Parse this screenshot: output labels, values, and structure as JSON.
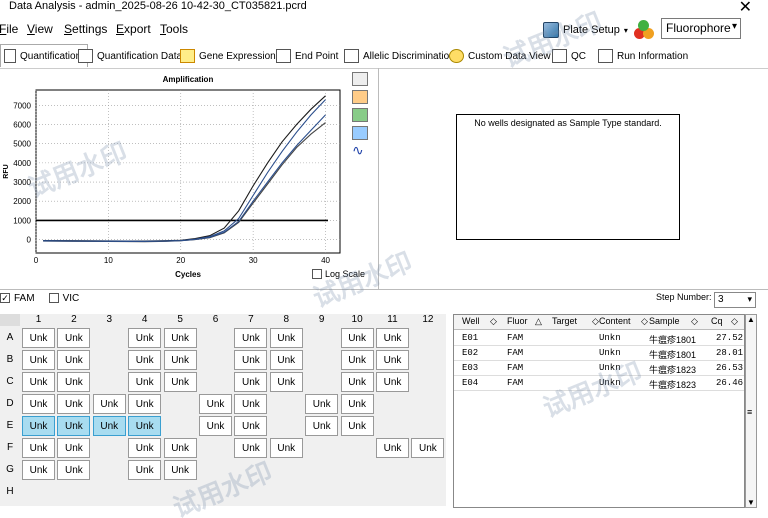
{
  "window": {
    "title": "Data Analysis - admin_2025-08-26 10-42-30_CT035821.pcrd",
    "close": "✕"
  },
  "menu": [
    {
      "key": "F",
      "rest": "ile"
    },
    {
      "key": "V",
      "rest": "iew"
    },
    {
      "key": "S",
      "rest": "ettings"
    },
    {
      "key": "E",
      "rest": "xport"
    },
    {
      "key": "T",
      "rest": "ools"
    }
  ],
  "toolbar": {
    "plate_setup": "Plate Setup",
    "fluor_select": "Fluorophore"
  },
  "tabs": [
    "Quantification",
    "Quantification Data",
    "Gene Expression",
    "End Point",
    "Allelic Discrimination",
    "Custom Data View",
    "QC",
    "Run Information"
  ],
  "chart_data": {
    "type": "line",
    "title": "Amplification",
    "xlabel": "Cycles",
    "ylabel": "RFU",
    "xlim": [
      0,
      42
    ],
    "ylim": [
      -700,
      7800
    ],
    "xticks": [
      0,
      10,
      20,
      30,
      40
    ],
    "yticks": [
      0,
      1000,
      2000,
      3000,
      4000,
      5000,
      6000,
      7000
    ],
    "threshold": 1000,
    "series": [
      {
        "color": "#1a1a1a",
        "x": [
          1,
          5,
          10,
          15,
          18,
          20,
          22,
          24,
          26,
          28,
          30,
          32,
          34,
          36,
          38,
          40
        ],
        "y": [
          -50,
          -60,
          -70,
          -80,
          -60,
          -40,
          50,
          200,
          600,
          1500,
          2800,
          4000,
          5100,
          6000,
          6800,
          7500
        ]
      },
      {
        "color": "#2b4e8c",
        "x": [
          1,
          5,
          10,
          15,
          18,
          20,
          22,
          24,
          26,
          28,
          30,
          32,
          34,
          36,
          38,
          40
        ],
        "y": [
          -60,
          -70,
          -80,
          -90,
          -70,
          -50,
          20,
          150,
          450,
          1100,
          2300,
          3500,
          4600,
          5600,
          6500,
          7300
        ]
      },
      {
        "color": "#444444",
        "x": [
          1,
          5,
          10,
          15,
          18,
          20,
          22,
          24,
          26,
          28,
          30,
          32,
          34,
          36,
          38,
          40
        ],
        "y": [
          -80,
          -90,
          -100,
          -110,
          -90,
          -60,
          0,
          100,
          350,
          900,
          1900,
          2900,
          3900,
          4800,
          5500,
          6100
        ]
      },
      {
        "color": "#2b4e8c",
        "x": [
          1,
          5,
          10,
          15,
          18,
          20,
          22,
          24,
          26,
          28,
          30,
          32,
          34,
          36,
          38,
          40
        ],
        "y": [
          -70,
          -80,
          -90,
          -100,
          -80,
          -60,
          10,
          120,
          380,
          950,
          2000,
          3000,
          4000,
          4900,
          5700,
          6500
        ]
      }
    ]
  },
  "log_scale_label": "Log Scale",
  "std_message": "No wells designated as Sample Type standard.",
  "fluor_filters": [
    {
      "label": "FAM",
      "checked": true
    },
    {
      "label": "VIC",
      "checked": false
    }
  ],
  "step": {
    "label": "Step Number:",
    "value": "3"
  },
  "plate": {
    "cols": [
      "1",
      "2",
      "3",
      "4",
      "5",
      "6",
      "7",
      "8",
      "9",
      "10",
      "11",
      "12"
    ],
    "rows": [
      "A",
      "B",
      "C",
      "D",
      "E",
      "F",
      "G",
      "H"
    ],
    "cell_label": "Unk",
    "wells": {
      "A": [
        1,
        2,
        4,
        5,
        7,
        8,
        10,
        11
      ],
      "B": [
        1,
        2,
        4,
        5,
        7,
        8,
        10,
        11
      ],
      "C": [
        1,
        2,
        4,
        5,
        7,
        8,
        10,
        11
      ],
      "D": [
        1,
        2,
        3,
        4,
        6,
        7,
        9,
        10
      ],
      "E": [
        1,
        2,
        3,
        4,
        6,
        7,
        9,
        10
      ],
      "F": [
        1,
        2,
        4,
        5,
        7,
        8,
        11,
        12
      ],
      "G": [
        1,
        2,
        4,
        5
      ],
      "H": []
    },
    "selected": {
      "E": [
        1,
        2,
        3,
        4
      ]
    }
  },
  "well_table": {
    "headers": [
      "Well",
      "Fluor",
      "Target",
      "Content",
      "Sample",
      "Cq"
    ],
    "rows": [
      [
        "E01",
        "FAM",
        "",
        "Unkn",
        "牛瘟疹1801",
        "27.52"
      ],
      [
        "E02",
        "FAM",
        "",
        "Unkn",
        "牛瘟疹1801",
        "28.01"
      ],
      [
        "E03",
        "FAM",
        "",
        "Unkn",
        "牛瘟疹1823",
        "26.53"
      ],
      [
        "E04",
        "FAM",
        "",
        "Unkn",
        "牛瘟疹1823",
        "26.46"
      ]
    ]
  },
  "watermark": "试用水印"
}
